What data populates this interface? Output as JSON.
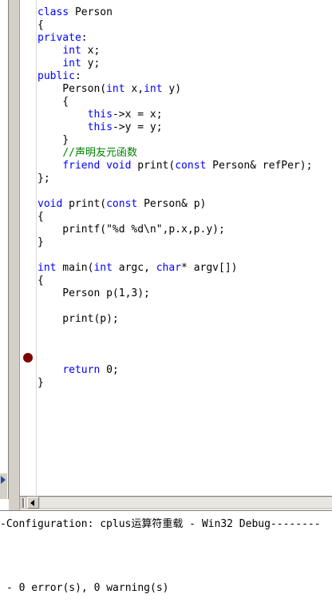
{
  "editor": {
    "breakpoint_line": 28,
    "lines": [
      [
        {
          "t": "kw",
          "s": "class"
        },
        {
          "t": "tx",
          "s": " Person"
        }
      ],
      [
        {
          "t": "tx",
          "s": "{"
        }
      ],
      [
        {
          "t": "kw",
          "s": "private"
        },
        {
          "t": "tx",
          "s": ":"
        }
      ],
      [
        {
          "t": "tx",
          "s": "    "
        },
        {
          "t": "kw",
          "s": "int"
        },
        {
          "t": "tx",
          "s": " x;"
        }
      ],
      [
        {
          "t": "tx",
          "s": "    "
        },
        {
          "t": "kw",
          "s": "int"
        },
        {
          "t": "tx",
          "s": " y;"
        }
      ],
      [
        {
          "t": "kw",
          "s": "public"
        },
        {
          "t": "tx",
          "s": ":"
        }
      ],
      [
        {
          "t": "tx",
          "s": "    Person("
        },
        {
          "t": "kw",
          "s": "int"
        },
        {
          "t": "tx",
          "s": " x,"
        },
        {
          "t": "kw",
          "s": "int"
        },
        {
          "t": "tx",
          "s": " y)"
        }
      ],
      [
        {
          "t": "tx",
          "s": "    {"
        }
      ],
      [
        {
          "t": "tx",
          "s": "        "
        },
        {
          "t": "kw",
          "s": "this"
        },
        {
          "t": "tx",
          "s": "->x = x;"
        }
      ],
      [
        {
          "t": "tx",
          "s": "        "
        },
        {
          "t": "kw",
          "s": "this"
        },
        {
          "t": "tx",
          "s": "->y = y;"
        }
      ],
      [
        {
          "t": "tx",
          "s": "    }"
        }
      ],
      [
        {
          "t": "tx",
          "s": "    "
        },
        {
          "t": "cm",
          "s": "//声明友元函数"
        }
      ],
      [
        {
          "t": "tx",
          "s": "    "
        },
        {
          "t": "kw",
          "s": "friend"
        },
        {
          "t": "tx",
          "s": " "
        },
        {
          "t": "kw",
          "s": "void"
        },
        {
          "t": "tx",
          "s": " print("
        },
        {
          "t": "kw",
          "s": "const"
        },
        {
          "t": "tx",
          "s": " Person& refPer);"
        }
      ],
      [
        {
          "t": "tx",
          "s": "};"
        }
      ],
      [],
      [
        {
          "t": "kw",
          "s": "void"
        },
        {
          "t": "tx",
          "s": " print("
        },
        {
          "t": "kw",
          "s": "const"
        },
        {
          "t": "tx",
          "s": " Person& p)"
        }
      ],
      [
        {
          "t": "tx",
          "s": "{"
        }
      ],
      [
        {
          "t": "tx",
          "s": "    printf(\"%d %d\\n\",p.x,p.y);"
        }
      ],
      [
        {
          "t": "tx",
          "s": "}"
        }
      ],
      [],
      [
        {
          "t": "kw",
          "s": "int"
        },
        {
          "t": "tx",
          "s": " main("
        },
        {
          "t": "kw",
          "s": "int"
        },
        {
          "t": "tx",
          "s": " argc, "
        },
        {
          "t": "kw",
          "s": "char"
        },
        {
          "t": "tx",
          "s": "* argv[])"
        }
      ],
      [
        {
          "t": "tx",
          "s": "{"
        }
      ],
      [
        {
          "t": "tx",
          "s": "    Person p(1,3);"
        }
      ],
      [],
      [
        {
          "t": "tx",
          "s": "    print(p);"
        }
      ],
      [],
      [],
      [],
      [
        {
          "t": "tx",
          "s": "    "
        },
        {
          "t": "kw",
          "s": "return"
        },
        {
          "t": "tx",
          "s": " 0;"
        }
      ],
      [
        {
          "t": "tx",
          "s": "}"
        }
      ]
    ]
  },
  "output": {
    "config_line": "-Configuration: cplus运算符重载 - Win32 Debug--------",
    "result_line": "- 0 error(s), 0 warning(s)"
  },
  "colors": {
    "keyword": "#0000ff",
    "comment": "#008000",
    "breakpoint": "#800000",
    "chrome": "#d4d0c8"
  }
}
